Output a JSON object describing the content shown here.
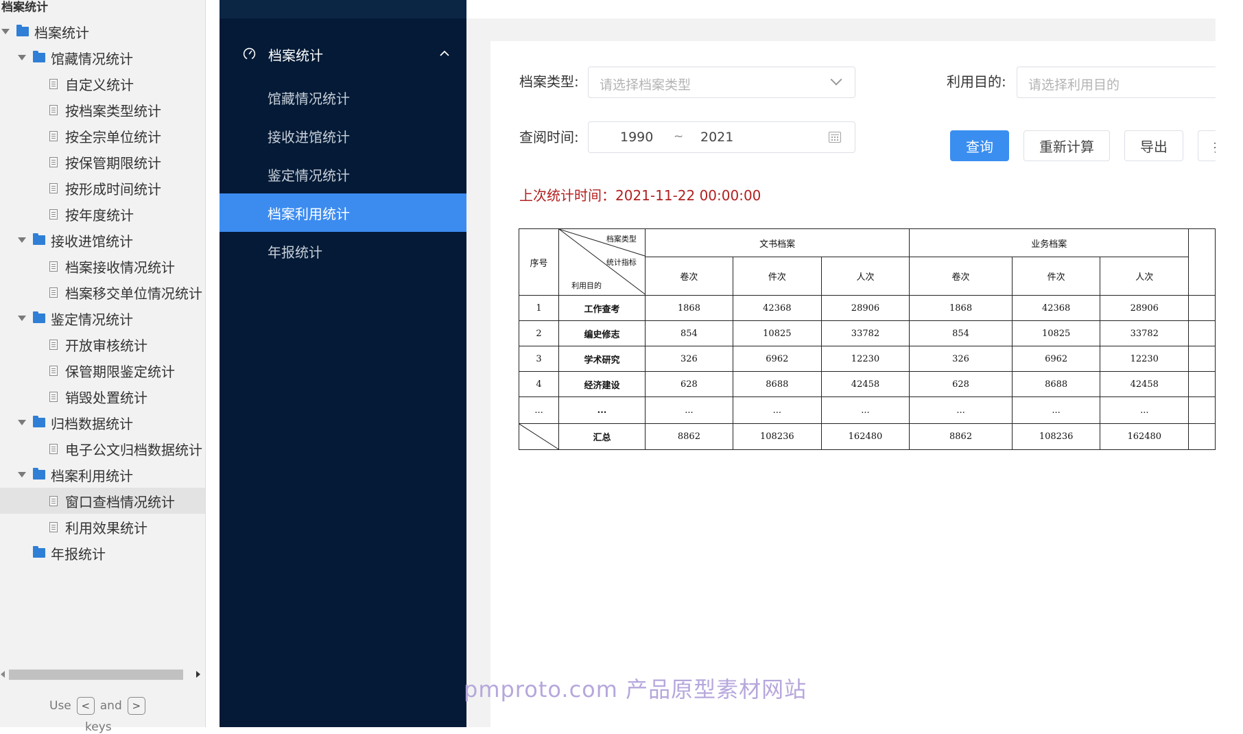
{
  "tree": {
    "title": "档案统计",
    "rows": [
      {
        "label": "档案统计",
        "type": "folder",
        "level": 0,
        "expanded": true
      },
      {
        "label": "馆藏情况统计",
        "type": "folder",
        "level": 1,
        "expanded": true
      },
      {
        "label": "自定义统计",
        "type": "doc",
        "level": 2
      },
      {
        "label": "按档案类型统计",
        "type": "doc",
        "level": 2
      },
      {
        "label": "按全宗单位统计",
        "type": "doc",
        "level": 2
      },
      {
        "label": "按保管期限统计",
        "type": "doc",
        "level": 2
      },
      {
        "label": "按形成时间统计",
        "type": "doc",
        "level": 2
      },
      {
        "label": "按年度统计",
        "type": "doc",
        "level": 2
      },
      {
        "label": "接收进馆统计",
        "type": "folder",
        "level": 1,
        "expanded": true
      },
      {
        "label": "档案接收情况统计",
        "type": "doc",
        "level": 2
      },
      {
        "label": "档案移交单位情况统计",
        "type": "doc",
        "level": 2
      },
      {
        "label": "鉴定情况统计",
        "type": "folder",
        "level": 1,
        "expanded": true
      },
      {
        "label": "开放审核统计",
        "type": "doc",
        "level": 2
      },
      {
        "label": "保管期限鉴定统计",
        "type": "doc",
        "level": 2
      },
      {
        "label": "销毁处置统计",
        "type": "doc",
        "level": 2
      },
      {
        "label": "归档数据统计",
        "type": "folder",
        "level": 1,
        "expanded": true
      },
      {
        "label": "电子公文归档数据统计",
        "type": "doc",
        "level": 2
      },
      {
        "label": "档案利用统计",
        "type": "folder",
        "level": 1,
        "expanded": true
      },
      {
        "label": "窗口查档情况统计",
        "type": "doc",
        "level": 2,
        "selected": true
      },
      {
        "label": "利用效果统计",
        "type": "doc",
        "level": 2
      },
      {
        "label": "年报统计",
        "type": "folder",
        "level": 1,
        "expanded": false
      }
    ],
    "hint_use": "Use",
    "hint_and": "and",
    "hint_key_prev": "<",
    "hint_key_next": ">",
    "hint_keys": "keys"
  },
  "nav": {
    "header_label": "档案统计",
    "header_icon": "gauge-icon",
    "items": [
      {
        "label": "馆藏情况统计",
        "active": false
      },
      {
        "label": "接收进馆统计",
        "active": false
      },
      {
        "label": "鉴定情况统计",
        "active": false
      },
      {
        "label": "档案利用统计",
        "active": true
      },
      {
        "label": "年报统计",
        "active": false
      }
    ],
    "active_color": "#3c8cf0",
    "bg_color": "#041a36"
  },
  "filters": {
    "archive_type_label": "档案类型:",
    "archive_type_placeholder": "请选择档案类型",
    "purpose_label": "利用目的:",
    "purpose_placeholder": "请选择利用目的",
    "time_label": "查阅时间:",
    "time_from": "1990",
    "time_sep": "~",
    "time_to": "2021"
  },
  "buttons": {
    "query": "查询",
    "recalc": "重新计算",
    "export": "导出",
    "print": "打印"
  },
  "last_stat_text": "上次统计时间：2021-11-22 00:00:00",
  "table": {
    "header_no": "序号",
    "diag_top": "档案类型",
    "diag_mid": "统计指标",
    "diag_bottom": "利用目的",
    "group_1": "文书档案",
    "group_2": "业务档案",
    "sub_1": "卷次",
    "sub_2": "件次",
    "sub_3": "人次",
    "rows": [
      {
        "no": "1",
        "purpose": "工作查考",
        "v": [
          "1868",
          "42368",
          "28906",
          "1868",
          "42368",
          "28906"
        ]
      },
      {
        "no": "2",
        "purpose": "编史修志",
        "v": [
          "854",
          "10825",
          "33782",
          "854",
          "10825",
          "33782"
        ]
      },
      {
        "no": "3",
        "purpose": "学术研究",
        "v": [
          "326",
          "6962",
          "12230",
          "326",
          "6962",
          "12230"
        ]
      },
      {
        "no": "4",
        "purpose": "经济建设",
        "v": [
          "628",
          "8688",
          "42458",
          "628",
          "8688",
          "42458"
        ]
      },
      {
        "no": "...",
        "purpose": "...",
        "v": [
          "...",
          "...",
          "...",
          "...",
          "...",
          "..."
        ]
      }
    ],
    "total_label": "汇总",
    "total": [
      "8862",
      "108236",
      "162480",
      "8862",
      "108236",
      "162480"
    ]
  },
  "watermark": "pmproto.com 产品原型素材网站"
}
